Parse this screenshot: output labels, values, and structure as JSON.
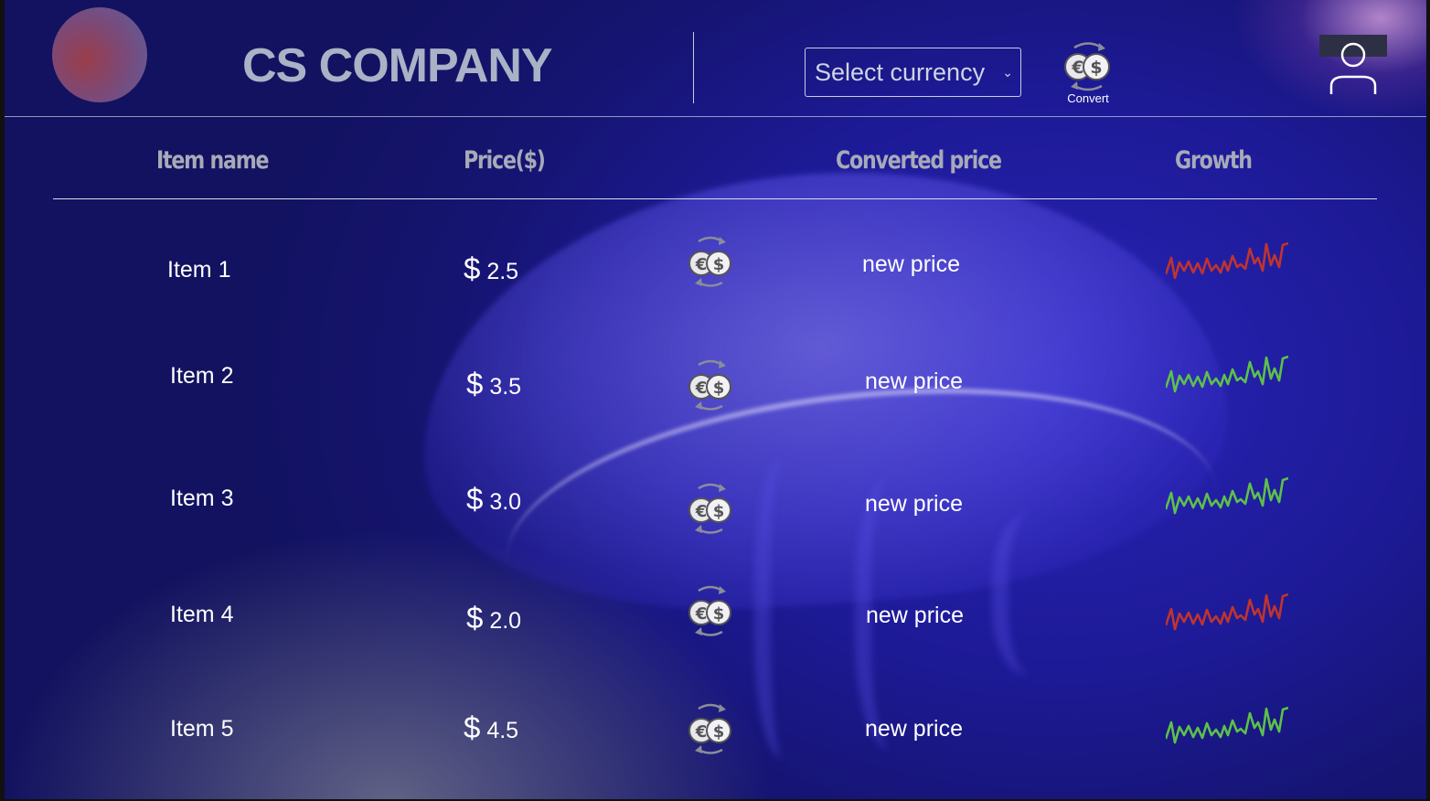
{
  "header": {
    "company_name": "CS COMPANY",
    "currency_select_placeholder": "Select currency",
    "convert_label": "Convert"
  },
  "table": {
    "columns": [
      "Item name",
      "Price($)",
      "Converted price",
      "Growth"
    ],
    "rows": [
      {
        "name": "Item 1",
        "currency": "$",
        "price": "2.5",
        "converted": "new price",
        "growth_trend": "down",
        "growth_color": "#c0342e"
      },
      {
        "name": "Item 2",
        "currency": "$",
        "price": "3.5",
        "converted": "new price",
        "growth_trend": "up",
        "growth_color": "#5cc14a"
      },
      {
        "name": "Item 3",
        "currency": "$",
        "price": "3.0",
        "converted": "new price",
        "growth_trend": "up",
        "growth_color": "#5cc14a"
      },
      {
        "name": "Item 4",
        "currency": "$",
        "price": "2.0",
        "converted": "new price",
        "growth_trend": "down",
        "growth_color": "#c0342e"
      },
      {
        "name": "Item 5",
        "currency": "$",
        "price": "4.5",
        "converted": "new price",
        "growth_trend": "up",
        "growth_color": "#5cc14a"
      }
    ]
  },
  "icons": {
    "logo": "logo-circle-icon",
    "convert": "currency-convert-icon",
    "profile": "user-profile-icon",
    "growth": "sparkline-icon"
  },
  "colors": {
    "growth_up": "#5cc14a",
    "growth_down": "#c0342e"
  }
}
